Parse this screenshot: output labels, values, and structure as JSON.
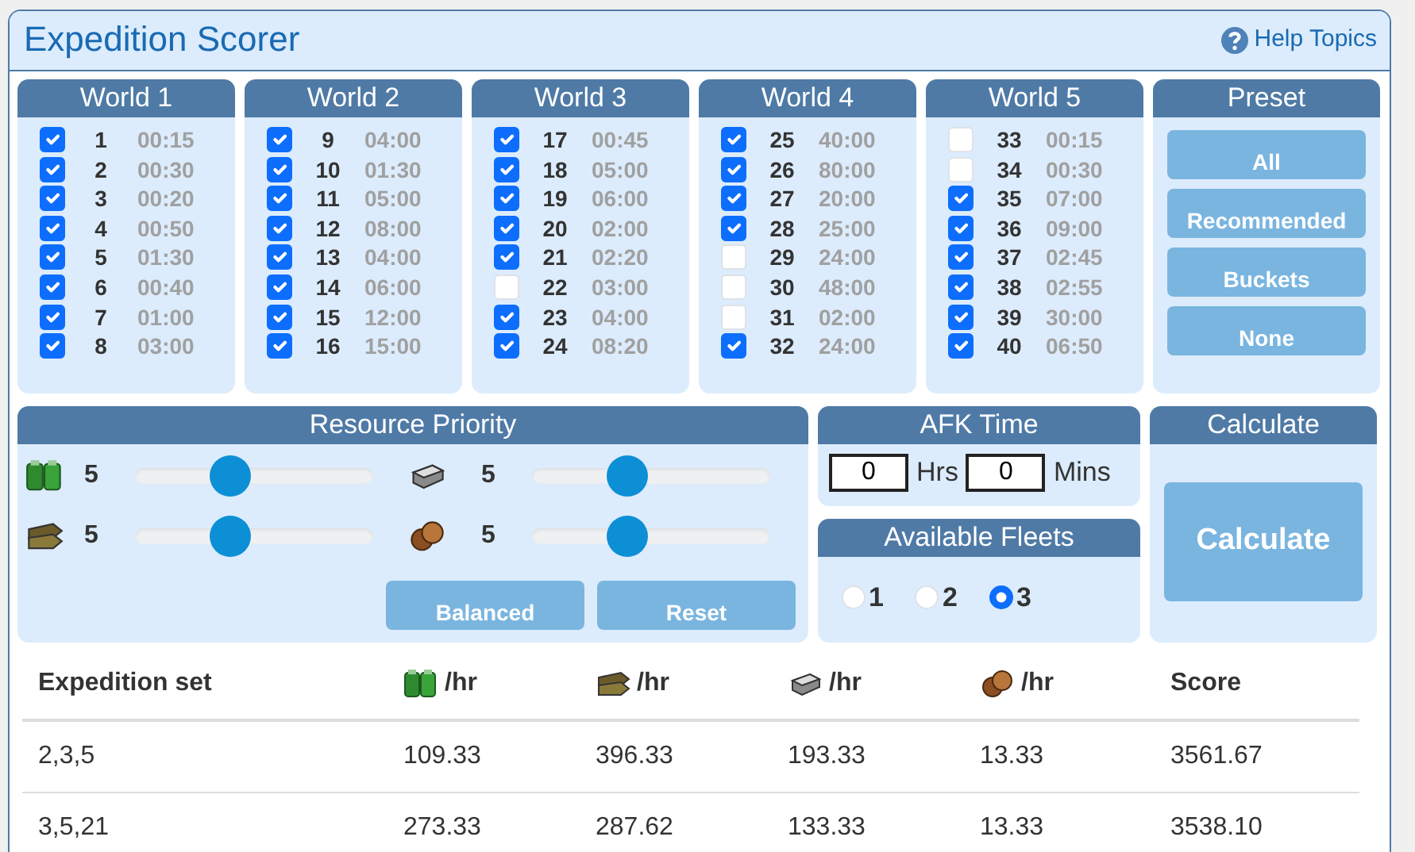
{
  "title": "Expedition Scorer",
  "help_link": "Help Topics",
  "worlds": [
    {
      "title": "World 1",
      "expeditions": [
        {
          "number": "1",
          "time": "00:15",
          "checked": true
        },
        {
          "number": "2",
          "time": "00:30",
          "checked": true
        },
        {
          "number": "3",
          "time": "00:20",
          "checked": true
        },
        {
          "number": "4",
          "time": "00:50",
          "checked": true
        },
        {
          "number": "5",
          "time": "01:30",
          "checked": true
        },
        {
          "number": "6",
          "time": "00:40",
          "checked": true
        },
        {
          "number": "7",
          "time": "01:00",
          "checked": true
        },
        {
          "number": "8",
          "time": "03:00",
          "checked": true
        }
      ]
    },
    {
      "title": "World 2",
      "expeditions": [
        {
          "number": "9",
          "time": "04:00",
          "checked": true
        },
        {
          "number": "10",
          "time": "01:30",
          "checked": true
        },
        {
          "number": "11",
          "time": "05:00",
          "checked": true
        },
        {
          "number": "12",
          "time": "08:00",
          "checked": true
        },
        {
          "number": "13",
          "time": "04:00",
          "checked": true
        },
        {
          "number": "14",
          "time": "06:00",
          "checked": true
        },
        {
          "number": "15",
          "time": "12:00",
          "checked": true
        },
        {
          "number": "16",
          "time": "15:00",
          "checked": true
        }
      ]
    },
    {
      "title": "World 3",
      "expeditions": [
        {
          "number": "17",
          "time": "00:45",
          "checked": true
        },
        {
          "number": "18",
          "time": "05:00",
          "checked": true
        },
        {
          "number": "19",
          "time": "06:00",
          "checked": true
        },
        {
          "number": "20",
          "time": "02:00",
          "checked": true
        },
        {
          "number": "21",
          "time": "02:20",
          "checked": true
        },
        {
          "number": "22",
          "time": "03:00",
          "checked": false
        },
        {
          "number": "23",
          "time": "04:00",
          "checked": true
        },
        {
          "number": "24",
          "time": "08:20",
          "checked": true
        }
      ]
    },
    {
      "title": "World 4",
      "expeditions": [
        {
          "number": "25",
          "time": "40:00",
          "checked": true
        },
        {
          "number": "26",
          "time": "80:00",
          "checked": true
        },
        {
          "number": "27",
          "time": "20:00",
          "checked": true
        },
        {
          "number": "28",
          "time": "25:00",
          "checked": true
        },
        {
          "number": "29",
          "time": "24:00",
          "checked": false
        },
        {
          "number": "30",
          "time": "48:00",
          "checked": false
        },
        {
          "number": "31",
          "time": "02:00",
          "checked": false
        },
        {
          "number": "32",
          "time": "24:00",
          "checked": true
        }
      ]
    },
    {
      "title": "World 5",
      "expeditions": [
        {
          "number": "33",
          "time": "00:15",
          "checked": false
        },
        {
          "number": "34",
          "time": "00:30",
          "checked": false
        },
        {
          "number": "35",
          "time": "07:00",
          "checked": true
        },
        {
          "number": "36",
          "time": "09:00",
          "checked": true
        },
        {
          "number": "37",
          "time": "02:45",
          "checked": true
        },
        {
          "number": "38",
          "time": "02:55",
          "checked": true
        },
        {
          "number": "39",
          "time": "30:00",
          "checked": true
        },
        {
          "number": "40",
          "time": "06:50",
          "checked": true
        }
      ]
    }
  ],
  "preset": {
    "title": "Preset",
    "buttons": [
      "All",
      "Recommended",
      "Buckets",
      "None"
    ]
  },
  "resource_priority": {
    "title": "Resource Priority",
    "resources": [
      {
        "kind": "fuel",
        "value": "5",
        "level": 0.4
      },
      {
        "kind": "steel",
        "value": "5",
        "level": 0.4
      },
      {
        "kind": "ammo",
        "value": "5",
        "level": 0.4
      },
      {
        "kind": "bauxite",
        "value": "5",
        "level": 0.4
      }
    ],
    "buttons": [
      "Balanced",
      "Reset"
    ]
  },
  "afk_time": {
    "title": "AFK Time",
    "fields": [
      {
        "value": "0",
        "unit": "Hrs"
      },
      {
        "value": "0",
        "unit": "Mins"
      }
    ]
  },
  "fleets": {
    "title": "Available Fleets",
    "options": [
      {
        "label": "1",
        "selected": false
      },
      {
        "label": "2",
        "selected": false
      },
      {
        "label": "3",
        "selected": true
      }
    ]
  },
  "calculate": {
    "title": "Calculate",
    "button": "Calculate"
  },
  "results": {
    "columns": [
      {
        "kind": "text",
        "label": "Expedition set"
      },
      {
        "kind": "fuel",
        "label": "/hr"
      },
      {
        "kind": "ammo",
        "label": "/hr"
      },
      {
        "kind": "steel",
        "label": "/hr"
      },
      {
        "kind": "bauxite",
        "label": "/hr"
      },
      {
        "kind": "text",
        "label": "Score"
      }
    ],
    "rows": [
      [
        "2,3,5",
        "109.33",
        "396.33",
        "193.33",
        "13.33",
        "3561.67"
      ],
      [
        "3,5,21",
        "273.33",
        "287.62",
        "133.33",
        "13.33",
        "3538.10"
      ]
    ]
  }
}
